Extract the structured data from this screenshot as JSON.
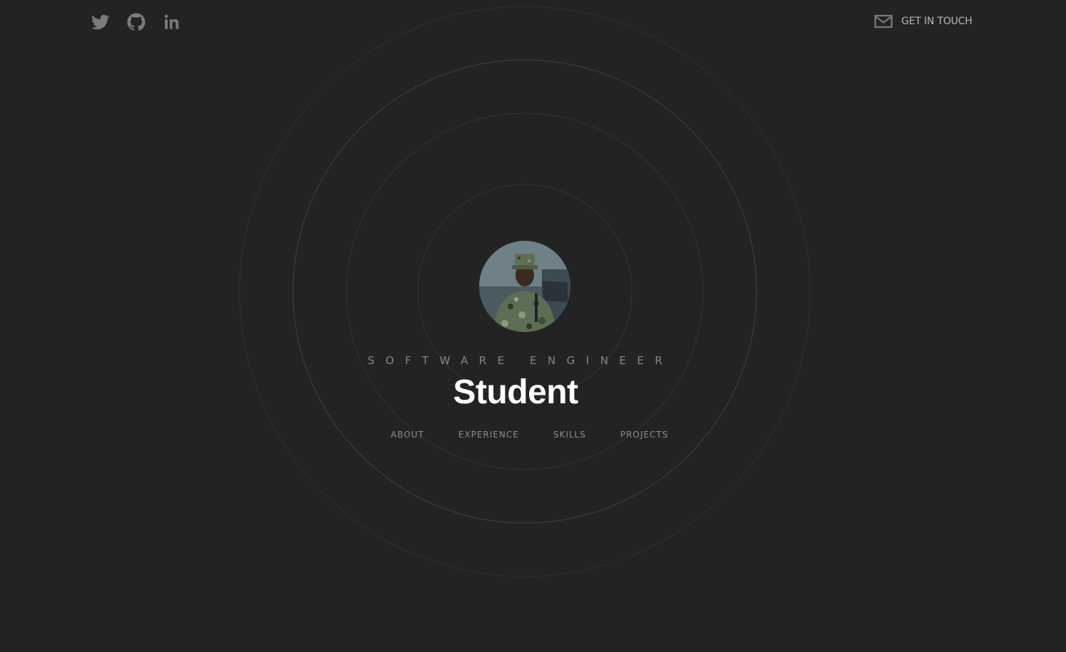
{
  "header": {
    "social_links": [
      {
        "name": "twitter",
        "icon": "twitter-icon"
      },
      {
        "name": "github",
        "icon": "github-icon"
      },
      {
        "name": "linkedin",
        "icon": "linkedin-icon"
      }
    ],
    "contact": {
      "icon": "mail-icon",
      "label": "GET IN TOUCH"
    }
  },
  "hero": {
    "role": "SOFTWARE ENGINEER",
    "name": "Student"
  },
  "nav": {
    "items": [
      {
        "label": "ABOUT"
      },
      {
        "label": "EXPERIENCE"
      },
      {
        "label": "SKILLS"
      },
      {
        "label": "PROJECTS"
      }
    ]
  },
  "theme": {
    "background": "#232323",
    "icon_color": "#7b7b7b",
    "ring_color": "#343434",
    "accent_ring_color": "#4e402b",
    "name_color": "#ffffff",
    "muted_text": "#8e8e8e"
  }
}
